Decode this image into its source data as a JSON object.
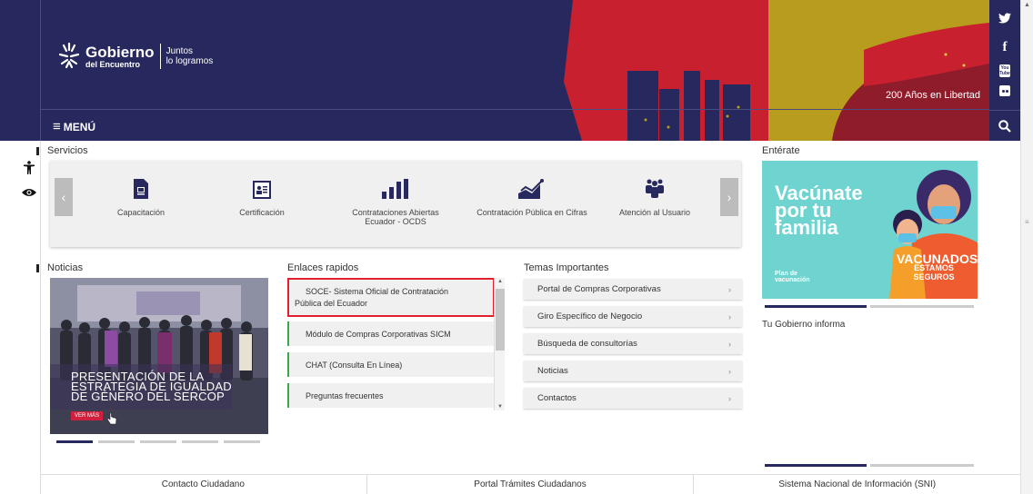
{
  "header": {
    "logo_main": "Gobierno",
    "logo_sub": "del Encuentro",
    "slogan_line1": "Juntos",
    "slogan_line2": "lo logramos",
    "anniversary": "200 Años en Libertad",
    "menu_label": "MENÚ",
    "colors": {
      "navy": "#27295e",
      "red": "#c8202f",
      "gold": "#b89c1e",
      "dark_red": "#8e1c2a"
    }
  },
  "social": [
    {
      "name": "twitter-icon",
      "glyph": "🐦"
    },
    {
      "name": "facebook-icon",
      "glyph": "f"
    },
    {
      "name": "youtube-icon",
      "glyph": "You Tube"
    },
    {
      "name": "flickr-icon",
      "glyph": "●●"
    },
    {
      "name": "search-icon",
      "glyph": "⚲"
    }
  ],
  "accessibility": [
    {
      "name": "accessibility-icon"
    },
    {
      "name": "eye-icon"
    }
  ],
  "servicios": {
    "title": "Servicios",
    "items": [
      {
        "label": "Capacitación",
        "icon": "capacitacion-icon"
      },
      {
        "label": "Certificación",
        "icon": "certificacion-icon"
      },
      {
        "label": "Contrataciones Abiertas Ecuador - OCDS",
        "icon": "bar-chart-icon"
      },
      {
        "label": "Contratación Pública en Cifras",
        "icon": "trend-chart-icon"
      },
      {
        "label": "Atención al Usuario",
        "icon": "users-icon"
      }
    ],
    "prev": "‹",
    "next": "›"
  },
  "noticias": {
    "title": "Noticias",
    "caption": [
      "PRESENTACIÓN DE LA",
      "ESTRATEGIA DE IGUALDAD",
      "DE GÉNERO DEL SERCOP"
    ],
    "ver_mas": "VER MÁS"
  },
  "enlaces": {
    "title": "Enlaces rapidos",
    "items": [
      {
        "line1": "SOCE- Sistema Oficial de Contratación",
        "line2": "Pública del Ecuador"
      },
      {
        "label": "Módulo de Compras Corporativas SICM"
      },
      {
        "label": "CHAT (Consulta En Línea)"
      },
      {
        "label": "Preguntas frecuentes"
      }
    ]
  },
  "temas": {
    "title": "Temas Importantes",
    "items": [
      "Portal de Compras Corporativas",
      "Giro Específico de Negocio",
      "Búsqueda de consultorías",
      "Noticias",
      "Contactos"
    ],
    "chevron": "›"
  },
  "enterate": {
    "title": "Entérate",
    "banner_line1": "Vacúnate",
    "banner_line2": "por tu",
    "banner_line3": "familia",
    "badge_line1": "VACUNADOS",
    "badge_line2": "ESTAMOS SEGUROS",
    "plan_line1": "Plan de",
    "plan_line2": "vacunación",
    "info_title": "Tu Gobierno informa"
  },
  "footer": {
    "links": [
      "Contacto Ciudadano",
      "Portal Trámites Ciudadanos",
      "Sistema Nacional de Información (SNI)"
    ]
  }
}
